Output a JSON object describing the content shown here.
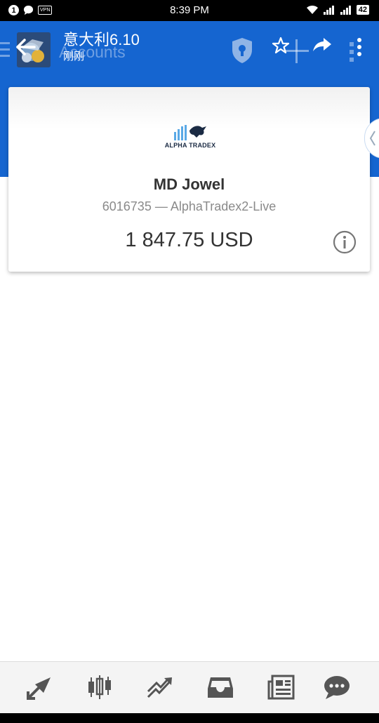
{
  "status_bar": {
    "time": "8:39 PM",
    "notification_count": "1",
    "vpn_label": "VPN",
    "battery": "42"
  },
  "app_bar": {
    "title": "意大利6.10",
    "subtitle": "刚刚",
    "ghost_title": "Accounts",
    "icons": [
      "back-arrow-icon",
      "app-logo",
      "shield-lock-icon",
      "star-icon",
      "plus-icon",
      "share-icon",
      "more-vert-icon"
    ]
  },
  "account": {
    "broker_logo_text": "ALPHA TRADEX",
    "name": "MD Jowel",
    "server_line": "6016735 — AlphaTradex2-Live",
    "balance": "1 847.75 USD"
  },
  "bottom_nav": {
    "items": [
      "quotes-icon",
      "chart-candles-icon",
      "trade-icon",
      "mailbox-icon",
      "news-icon",
      "chat-icon"
    ]
  },
  "colors": {
    "primary": "#1565d0",
    "nav_icon": "#555555",
    "card_bg": "#ffffff"
  }
}
